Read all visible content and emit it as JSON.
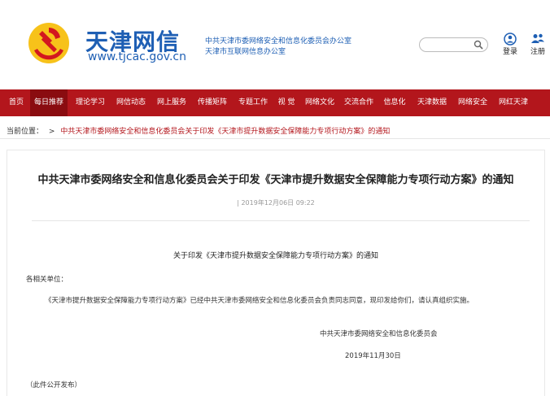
{
  "header": {
    "logo_cn": "天津网信",
    "logo_url": "www.tjcac.gov.cn",
    "org_line1": "中共天津市委网络安全和信息化委员会办公室",
    "org_line2": "天津市互联网信息办公室",
    "search_placeholder": "",
    "login_label": "登录",
    "register_label": "注册"
  },
  "nav": {
    "items": [
      {
        "label": "首页"
      },
      {
        "label": "每日推荐"
      },
      {
        "label": "理论学习"
      },
      {
        "label": "网信动态"
      },
      {
        "label": "网上服务"
      },
      {
        "label": "传播矩阵"
      },
      {
        "label": "专题工作"
      },
      {
        "label": "视 觉"
      },
      {
        "label": "网络文化"
      },
      {
        "label": "交流合作"
      },
      {
        "label": "信息化"
      },
      {
        "label": "天津数据"
      },
      {
        "label": "网络安全"
      },
      {
        "label": "网红天津"
      }
    ],
    "active_index": 1
  },
  "breadcrumb": {
    "prefix": "当前位置：",
    "separator": ">",
    "link": "中共天津市委网络安全和信息化委员会关于印发《天津市提升数据安全保障能力专项行动方案》的通知"
  },
  "article": {
    "title": "中共天津市委网络安全和信息化委员会关于印发《天津市提升数据安全保障能力专项行动方案》的通知",
    "date": "| 2019年12月06日 09:22",
    "subhead": "关于印发《天津市提升数据安全保障能力专项行动方案》的通知",
    "salutation": "各相关单位：",
    "body": "《天津市提升数据安全保障能力专项行动方案》已经中共天津市委网络安全和信息化委员会负责同志同意，现印发给你们，请认真组织实施。",
    "signature": "中共天津市委网络安全和信息化委员会",
    "sign_date": "2019年11月30日",
    "note": "（此件公开发布）"
  },
  "colors": {
    "brand_blue": "#1e5fb4",
    "nav_red": "#b3161c",
    "nav_active": "#8a0c10"
  },
  "icons": {
    "emblem": "party-emblem-icon",
    "search": "search-icon",
    "login": "user-icon",
    "register": "users-icon"
  }
}
